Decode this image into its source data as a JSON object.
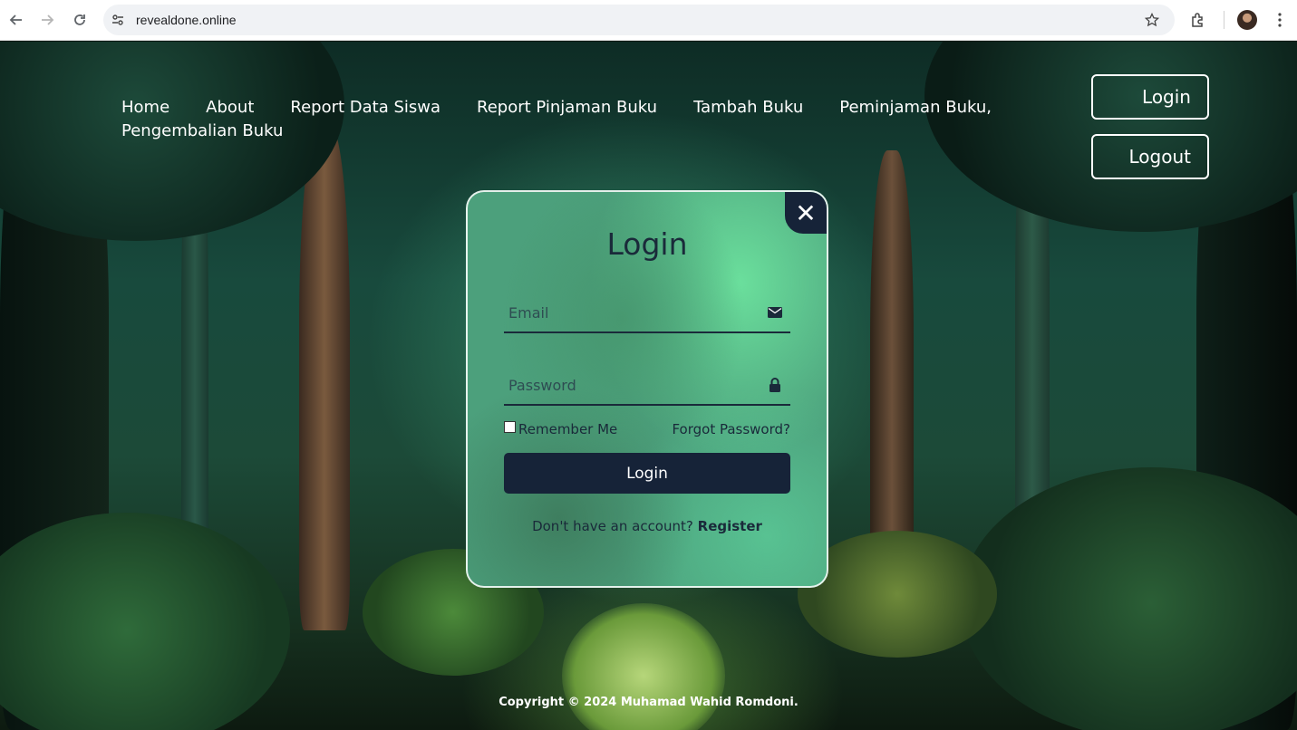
{
  "browser": {
    "url": "revealdone.online",
    "icons": {
      "back": "back-arrow-icon",
      "forward": "forward-arrow-icon",
      "reload": "reload-icon",
      "site_info": "site-info-icon",
      "bookmark": "star-icon",
      "extensions": "puzzle-icon",
      "profile": "avatar",
      "menu": "kebab-menu-icon"
    }
  },
  "nav": {
    "items": [
      {
        "label": "Home"
      },
      {
        "label": "About"
      },
      {
        "label": "Report Data Siswa"
      },
      {
        "label": "Report Pinjaman Buku"
      },
      {
        "label": "Tambah Buku"
      },
      {
        "label": "Peminjaman Buku,"
      },
      {
        "label": "Pengembalian Buku"
      }
    ]
  },
  "header_buttons": {
    "login": "Login",
    "logout": "Logout"
  },
  "login_card": {
    "title": "Login",
    "email_placeholder": "Email",
    "password_placeholder": "Password",
    "remember_label": "Remember Me",
    "forgot_label": "Forgot Password?",
    "submit_label": "Login",
    "register_prompt": "Don't have an account?",
    "register_link": "Register",
    "close_glyph": "✕"
  },
  "footer": {
    "copyright": "Copyright © 2024 Muhamad Wahid Romdoni."
  },
  "colors": {
    "accent_dark": "#162338",
    "card_green": "#4ca07c"
  }
}
